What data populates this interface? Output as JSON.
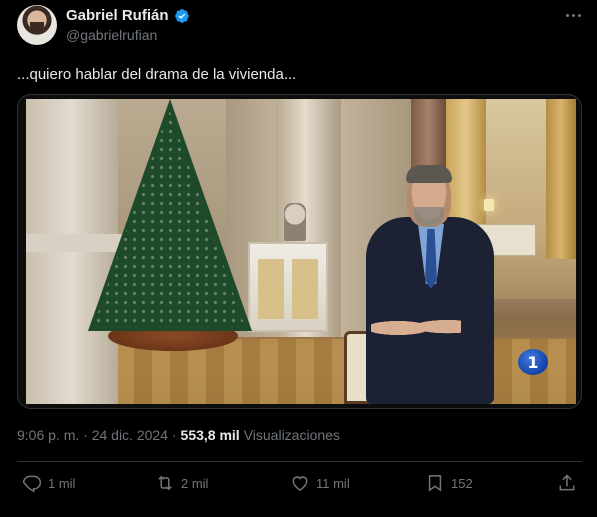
{
  "author": {
    "display_name": "Gabriel Rufián",
    "handle": "@gabrielrufian",
    "verified": true
  },
  "tweet": {
    "text": "...quiero hablar del drama de la vivienda...",
    "timestamp": "9:06 p. m. · 24 dic. 2024 ·",
    "views_count": "553,8 mil",
    "views_label": "Visualizaciones"
  },
  "media": {
    "channel_badge": "1"
  },
  "actions": {
    "replies": "1 mil",
    "reposts": "2 mil",
    "likes": "11 mil",
    "bookmarks": "152"
  },
  "icons": {
    "verified": "verified-badge-icon",
    "more": "more-options-icon",
    "reply": "reply-icon",
    "repost": "repost-icon",
    "like": "heart-icon",
    "bookmark": "bookmark-icon",
    "share": "share-icon"
  },
  "colors": {
    "background": "#000000",
    "text": "#e7e9ea",
    "muted": "#71767b",
    "verified": "#1d9bf0",
    "border": "#2f3336"
  }
}
